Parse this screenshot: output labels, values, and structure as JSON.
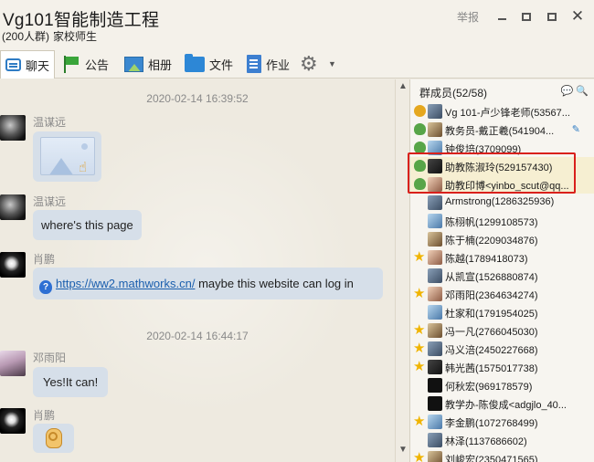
{
  "header": {
    "title": "Vg101智能制造工程",
    "member_count": "(200人群)",
    "group_type": "家校师生",
    "report_label": "举报",
    "close_glyph": "✕"
  },
  "toolbar": {
    "items": [
      {
        "label": "聊天",
        "icon": "chat-icon"
      },
      {
        "label": "公告",
        "icon": "flag-icon"
      },
      {
        "label": "相册",
        "icon": "photo-icon"
      },
      {
        "label": "文件",
        "icon": "folder-icon"
      },
      {
        "label": "作业",
        "icon": "document-icon"
      },
      {
        "label": "",
        "icon": "gear-icon"
      }
    ]
  },
  "chat": {
    "timestamps": [
      "2020-02-14 16:39:52",
      "2020-02-14 16:44:17"
    ],
    "messages": [
      {
        "sender": "温谋远",
        "type": "image",
        "text": ""
      },
      {
        "sender": "温谋远",
        "type": "text",
        "text": "where's this page"
      },
      {
        "sender": "肖鹏",
        "type": "link",
        "link": "https://ww2.mathworks.cn/",
        "text": " maybe this website can log in"
      },
      {
        "sender": "邓雨阳",
        "type": "text",
        "text": "Yes!It can!"
      },
      {
        "sender": "肖鹏",
        "type": "emoji",
        "text": ""
      }
    ]
  },
  "members": {
    "header": "群成员(52/58)",
    "list": [
      {
        "name": "Vg 101-卢少锋老师(53567...",
        "role": "owner"
      },
      {
        "name": "教务员-戴正羲(541904...",
        "role": "admin"
      },
      {
        "name": "钟俊培(3709099)",
        "role": "admin"
      },
      {
        "name": "助教陈淑玲(529157430)",
        "role": "admin"
      },
      {
        "name": "助教印博<yinbo_scut@qq...",
        "role": "admin"
      },
      {
        "name": "Armstrong(1286325936)",
        "role": "member"
      },
      {
        "name": "陈栩帆(1299108573)",
        "role": "member"
      },
      {
        "name": "陈于楠(2209034876)",
        "role": "member"
      },
      {
        "name": "陈越(1789418073)",
        "role": "star"
      },
      {
        "name": "从凯宣(1526880874)",
        "role": "member"
      },
      {
        "name": "邓雨阳(2364634274)",
        "role": "star"
      },
      {
        "name": "杜家和(1791954025)",
        "role": "member"
      },
      {
        "name": "冯一凡(2766045030)",
        "role": "star"
      },
      {
        "name": "冯义涪(2450227668)",
        "role": "star"
      },
      {
        "name": "韩光茜(1575017738)",
        "role": "star"
      },
      {
        "name": "何秋宏(969178579)",
        "role": "member"
      },
      {
        "name": "教学办-陈俊成<adgjlo_40...",
        "role": "member"
      },
      {
        "name": "李金鹏(1072768499)",
        "role": "star"
      },
      {
        "name": "林泽(1137686602)",
        "role": "member"
      },
      {
        "name": "刘峻宏(2350471565)",
        "role": "star"
      }
    ]
  }
}
